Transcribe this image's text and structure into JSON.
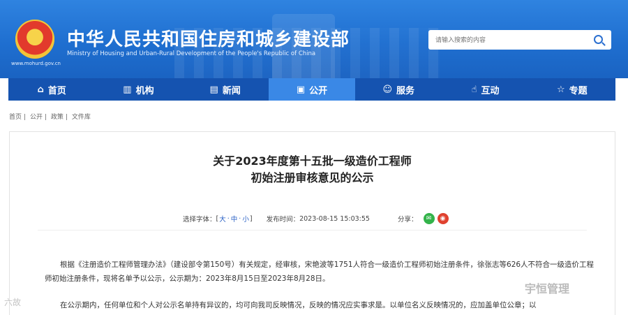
{
  "header": {
    "site_title_cn": "中华人民共和国住房和城乡建设部",
    "site_title_en": "Ministry of Housing and Urban-Rural Development of the People's Republic of China",
    "site_url": "www.mohurd.gov.cn",
    "search_placeholder": "请输入搜索的内容"
  },
  "nav": {
    "items": [
      {
        "label": "首页",
        "icon": "home-icon"
      },
      {
        "label": "机构",
        "icon": "building-icon"
      },
      {
        "label": "新闻",
        "icon": "news-icon"
      },
      {
        "label": "公开",
        "icon": "disclosure-icon",
        "active": true
      },
      {
        "label": "服务",
        "icon": "service-icon"
      },
      {
        "label": "互动",
        "icon": "interaction-icon"
      },
      {
        "label": "专题",
        "icon": "topic-icon"
      }
    ]
  },
  "breadcrumb": [
    "首页",
    "公开",
    "政策",
    "文件库"
  ],
  "article": {
    "title_line1": "关于2023年度第十五批一级造价工程师",
    "title_line2": "初始注册审核意见的公示",
    "font_size_label": "选择字体：",
    "font_sizes": [
      "大",
      "中",
      "小"
    ],
    "publish_label": "发布时间：",
    "publish_time": "2023-08-15 15:03:55",
    "share_label": "分享：",
    "paragraph1": "根据《注册造价工程师管理办法》（建设部令第150号）有关规定，经审核，宋艳波等1751人符合一级造价工程师初始注册条件，徐张志等626人不符合一级造价工程师初始注册条件，现将名单予以公示，公示期为：2023年8月15日至2023年8月28日。",
    "paragraph2": "在公示期内，任何单位和个人对公示名单持有异议的，均可向我司反映情况，反映的情况应实事求是。以单位名义反映情况的，应加盖单位公章；以"
  },
  "watermarks": {
    "right": "宇恒管理",
    "left": "六故"
  },
  "colors": {
    "header_blue": "#1f6fd0",
    "nav_blue": "#1553b0",
    "nav_active": "#3a88e6"
  }
}
